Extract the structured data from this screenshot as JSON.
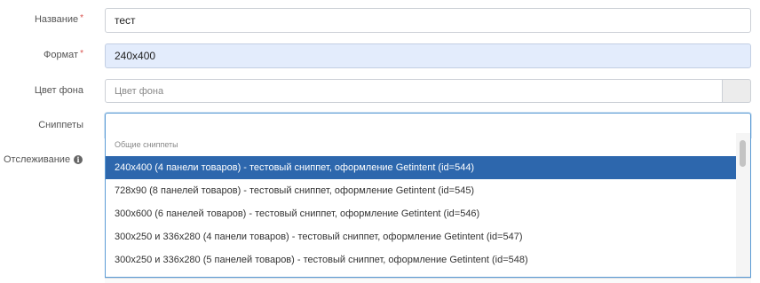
{
  "form": {
    "name": {
      "label": "Название",
      "required_mark": "*",
      "value": "тест"
    },
    "format": {
      "label": "Формат",
      "required_mark": "*",
      "value": "240x400"
    },
    "bg_color": {
      "label": "Цвет фона",
      "placeholder": "Цвет фона"
    },
    "snippets": {
      "label": "Сниппеты",
      "value": ""
    },
    "tracking": {
      "label": "Отслеживание",
      "info_icon": "info-icon"
    }
  },
  "dropdown": {
    "group_label": "Общие сниппеты",
    "options": [
      {
        "label": "240x400 (4 панели товаров) - тестовый сниппет, оформление Getintent (id=544)",
        "selected": true
      },
      {
        "label": "728x90 (8 панелей товаров) - тестовый сниппет, оформление Getintent (id=545)",
        "selected": false
      },
      {
        "label": "300x600 (6 панелей товаров) - тестовый сниппет, оформление Getintent (id=546)",
        "selected": false
      },
      {
        "label": "300x250 и 336x280 (4 панели товаров) - тестовый сниппет, оформление Getintent (id=547)",
        "selected": false
      },
      {
        "label": "300x250 и 336x280 (5 панелей товаров) - тестовый сниппет, оформление Getintent (id=548)",
        "selected": false
      }
    ]
  },
  "colors": {
    "selected_option_bg": "#2d67ad",
    "required_mark": "#d9534f",
    "format_field_bg": "#e3ecfc",
    "focus_border": "#5b9bd5"
  }
}
